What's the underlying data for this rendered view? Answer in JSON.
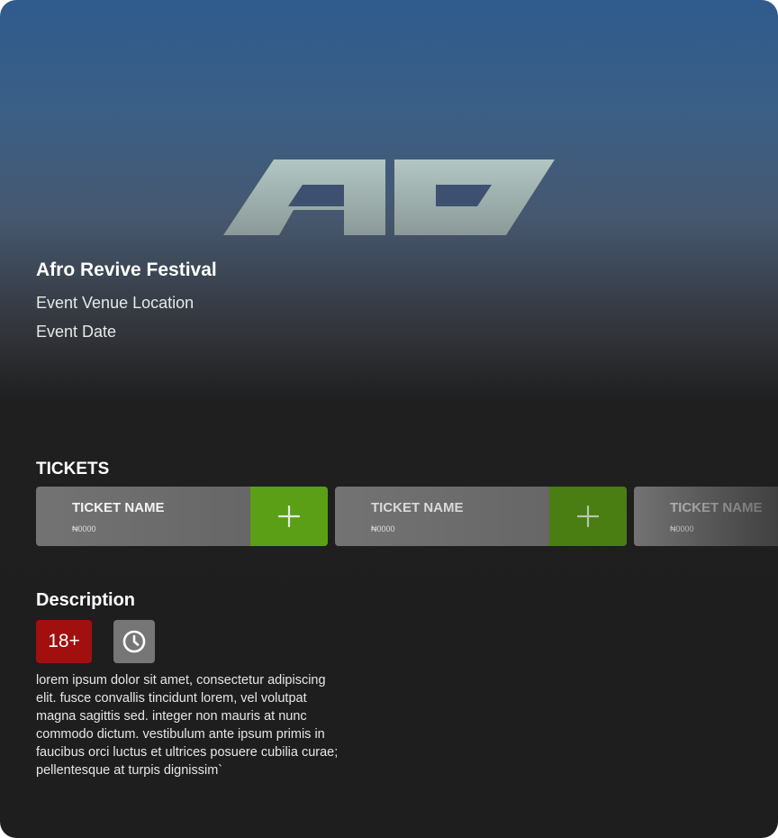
{
  "event": {
    "title": "Afro Revive Festival",
    "venue": "Event Venue Location",
    "date": "Event Date"
  },
  "sections": {
    "tickets_heading": "TICKETS",
    "description_heading": "Description"
  },
  "tickets": [
    {
      "name": "TICKET NAME",
      "price": "₦0000"
    },
    {
      "name": "TICKET NAME",
      "price": "₦0000"
    },
    {
      "name": "TICKET NAME",
      "price": "₦0000"
    }
  ],
  "badges": {
    "age_rating": "18+",
    "duration_icon": "clock-icon"
  },
  "description": {
    "body": "lorem ipsum dolor sit amet, consectetur adipiscing elit. fusce convallis tincidunt lorem, vel volutpat magna sagittis sed. integer non mauris at nunc commodo dictum. vestibulum ante ipsum primis in faucibus orci luctus et ultrices posuere cubilia curae; pellentesque at turpis dignissim`"
  },
  "colors": {
    "header_blue": "#2f5b8d",
    "background_dark": "#1e1e1e",
    "ticket_card": "#6b6b6b",
    "add_button_green": "#5a9f16",
    "age_badge_red": "#a10f0f",
    "clock_badge_gray": "#767676",
    "logo_tint": "#a6bcbb"
  },
  "icons": {
    "logo": "festival-logo",
    "add": "plus-icon",
    "duration": "clock-icon"
  }
}
